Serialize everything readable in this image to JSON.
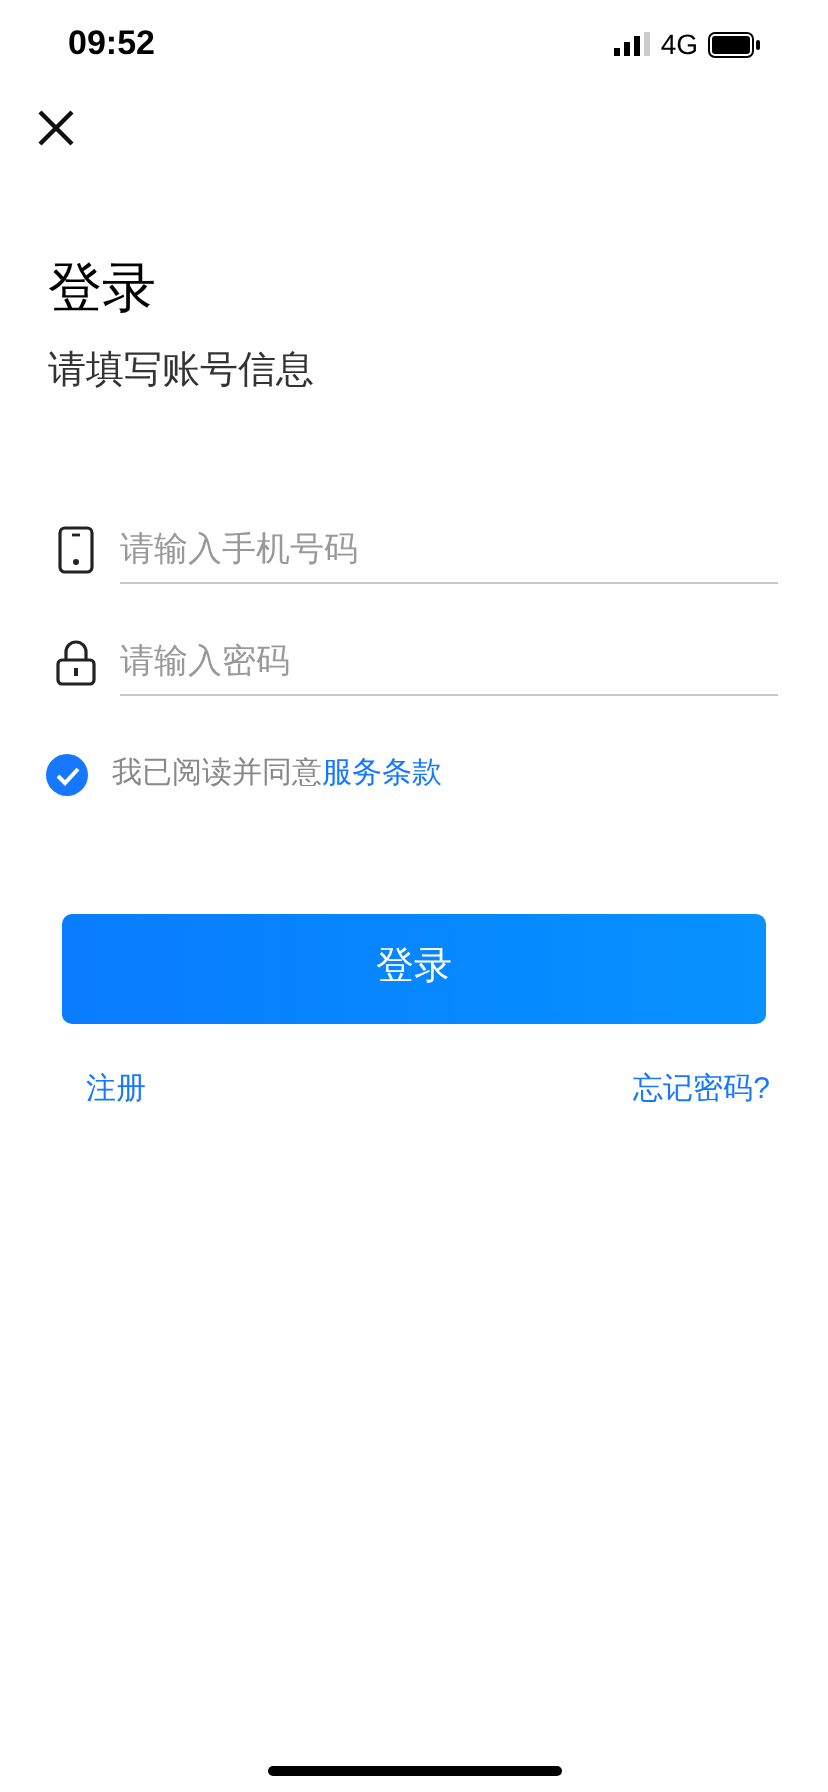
{
  "status_bar": {
    "time": "09:52",
    "network": "4G"
  },
  "title": "登录",
  "subtitle": "请填写账号信息",
  "fields": [
    {
      "kind": "phone",
      "placeholder": "请输入手机号码"
    },
    {
      "kind": "password",
      "placeholder": "请输入密码"
    }
  ],
  "agreement": {
    "checked": true,
    "text": "我已阅读并同意",
    "link": "服务条款"
  },
  "login_button": "登录",
  "links": {
    "register": "注册",
    "forgot": "忘记密码?"
  }
}
